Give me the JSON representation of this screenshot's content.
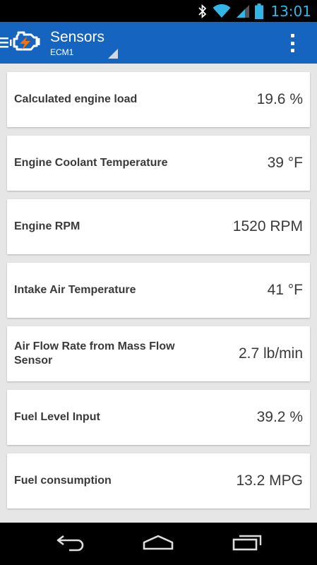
{
  "status_bar": {
    "time": "13:01",
    "icons": [
      "bluetooth-icon",
      "wifi-icon",
      "cell-signal-icon",
      "battery-icon"
    ],
    "time_color": "#33b5e5"
  },
  "action_bar": {
    "title": "Sensors",
    "subtitle": "ECM1",
    "background_color": "#1565c0",
    "icons": [
      "up-navigation-icon",
      "engine-check-logo-icon",
      "spinner-triangle-icon",
      "overflow-menu-icon"
    ]
  },
  "sensors": [
    {
      "label": "Calculated engine load",
      "value": "19.6 %"
    },
    {
      "label": "Engine Coolant Temperature",
      "value": "39 °F"
    },
    {
      "label": "Engine RPM",
      "value": "1520 RPM"
    },
    {
      "label": "Intake Air Temperature",
      "value": "41 °F"
    },
    {
      "label": "Air Flow Rate from Mass Flow Sensor",
      "value": "2.7 lb/min"
    },
    {
      "label": "Fuel Level Input",
      "value": "39.2 %"
    },
    {
      "label": "Fuel consumption",
      "value": "13.2 MPG"
    }
  ],
  "navigation_bar": {
    "buttons": [
      "back-icon",
      "home-icon",
      "recent-apps-icon"
    ]
  }
}
